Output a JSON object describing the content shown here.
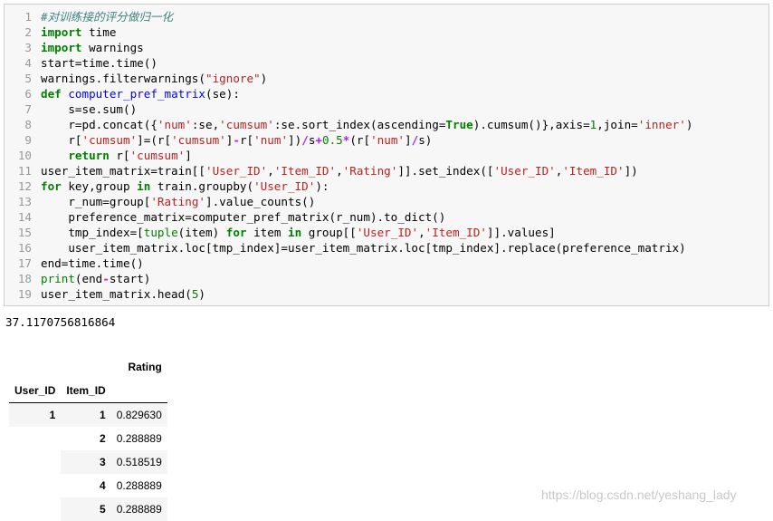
{
  "code": {
    "lines": [
      "#对训练接的评分做归一化",
      "import time",
      "import warnings",
      "start=time.time()",
      "warnings.filterwarnings(\"ignore\")",
      "def computer_pref_matrix(se):",
      "    s=se.sum()",
      "    r=pd.concat({'num':se,'cumsum':se.sort_index(ascending=True).cumsum()},axis=1,join='inner')",
      "    r['cumsum']=(r['cumsum']-r['num'])/s+0.5*(r['num']/s)",
      "    return r['cumsum']",
      "user_item_matrix=train[['User_ID','Item_ID','Rating']].set_index(['User_ID','Item_ID'])",
      "for key,group in train.groupby('User_ID'):",
      "    r_num=group['Rating'].value_counts()",
      "    preference_matrix=computer_pref_matrix(r_num).to_dict()",
      "    tmp_index=[tuple(item) for item in group[['User_ID','Item_ID']].values]",
      "    user_item_matrix.loc[tmp_index]=user_item_matrix.loc[tmp_index].replace(preference_matrix)",
      "end=time.time()",
      "print(end-start)",
      "user_item_matrix.head(5)"
    ]
  },
  "output": {
    "elapsed": "37.1170756816864"
  },
  "table": {
    "value_column": "Rating",
    "index_names": [
      "User_ID",
      "Item_ID"
    ],
    "rows": [
      {
        "user": "1",
        "item": "1",
        "rating": "0.829630"
      },
      {
        "user": "",
        "item": "2",
        "rating": "0.288889"
      },
      {
        "user": "",
        "item": "3",
        "rating": "0.518519"
      },
      {
        "user": "",
        "item": "4",
        "rating": "0.288889"
      },
      {
        "user": "",
        "item": "5",
        "rating": "0.288889"
      }
    ]
  },
  "watermark": "https://blog.csdn.net/yeshang_lady"
}
